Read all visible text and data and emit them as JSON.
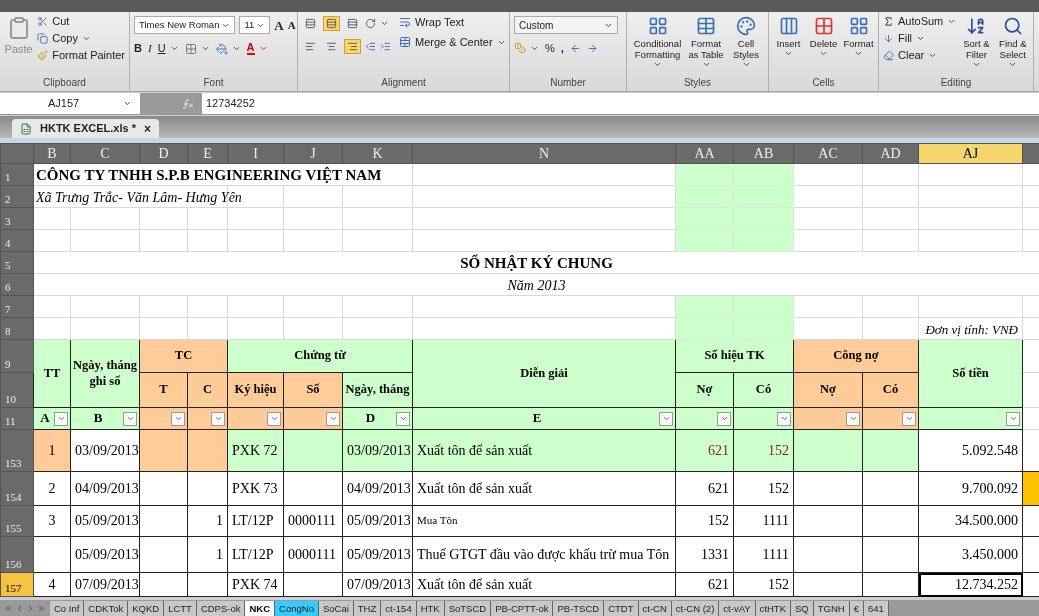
{
  "ribbon": {
    "clipboard": {
      "label": "Clipboard",
      "paste": "Paste",
      "cut": "Cut",
      "copy": "Copy",
      "format_painter": "Format Painter"
    },
    "font": {
      "label": "Font",
      "font_name": "Times New Roman",
      "font_size": "11",
      "grow": "A",
      "shrink": "A",
      "bold": "B",
      "italic": "I",
      "underline": "U",
      "font_color": "A"
    },
    "alignment": {
      "label": "Alignment",
      "vertical": [
        {
          "selected": false
        },
        {
          "selected": true
        },
        {
          "selected": false
        }
      ],
      "horizontal": [
        {
          "selected": false
        },
        {
          "selected": false
        },
        {
          "selected": true
        }
      ],
      "wrap_text": "Wrap Text",
      "merge_center": "Merge & Center"
    },
    "number": {
      "label": "Number",
      "format": "Custom",
      "percent": "%",
      "comma": ","
    },
    "styles": {
      "label": "Styles",
      "buttons": [
        "Conditional Formatting",
        "Format as Table",
        "Cell Styles"
      ]
    },
    "cells": {
      "label": "Cells",
      "buttons": [
        "Insert",
        "Delete",
        "Format"
      ]
    },
    "editing": {
      "label": "Editing",
      "autosum": "AutoSum",
      "fill": "Fill",
      "clear": "Clear",
      "buttons": [
        "Sort & Filter",
        "Find & Select"
      ]
    }
  },
  "formula_bar": {
    "name_box": "AJ157",
    "formula": "12734252"
  },
  "document_tab": {
    "title": "HKTK EXCEL.xls *",
    "close": "×"
  },
  "columns": [
    {
      "label": "B",
      "selected": false
    },
    {
      "label": "C",
      "selected": false
    },
    {
      "label": "D",
      "selected": false
    },
    {
      "label": "E",
      "selected": false
    },
    {
      "label": "I",
      "selected": false
    },
    {
      "label": "J",
      "selected": false
    },
    {
      "label": "K",
      "selected": false
    },
    {
      "label": "N",
      "selected": false
    },
    {
      "label": "AA",
      "selected": false
    },
    {
      "label": "AB",
      "selected": false
    },
    {
      "label": "AC",
      "selected": false
    },
    {
      "label": "AD",
      "selected": false
    },
    {
      "label": "AJ",
      "selected": true
    }
  ],
  "sheet_heading": {
    "company": "CÔNG TY TNHH S.P.B ENGINEERING VIỆT NAM",
    "address": "Xã Trưng Trắc- Văn Lâm- Hưng Yên",
    "title": "SỔ NHẬT KÝ CHUNG",
    "year": "Năm 2013",
    "unit": "Đơn vị tính: VNĐ"
  },
  "heading_rows": [
    "1",
    "2",
    "3",
    "4",
    "5",
    "6",
    "7",
    "8"
  ],
  "header_rows": [
    "9",
    "10",
    "11"
  ],
  "header_top": [
    {
      "text": "TT",
      "color": "#ccffcc"
    },
    {
      "text": "Ngày, tháng ghi sổ",
      "color": "#ccffcc"
    },
    {
      "text": "TC",
      "color": "#ffcc99"
    },
    {
      "text": "Chứng từ",
      "color": "#ccffcc"
    },
    {
      "text": "Diễn giải",
      "color": "#ccffcc"
    },
    {
      "text": "Số hiệu TK",
      "color": "#ccffcc"
    },
    {
      "text": "Công nợ",
      "color": "#ffcc99"
    },
    {
      "text": "Số tiền",
      "color": "#ccffcc"
    }
  ],
  "header_sub": [
    {
      "text": "T",
      "color": "#ffcc99"
    },
    {
      "text": "C",
      "color": "#ffcc99"
    },
    {
      "text": "Ký hiệu",
      "color": "#ffcc99"
    },
    {
      "text": "Số",
      "color": "#ffcc99"
    },
    {
      "text": "Ngày, tháng",
      "color": "#ccffcc"
    },
    {
      "text": "Nợ",
      "color": "#ccffcc"
    },
    {
      "text": "Có",
      "color": "#ccffcc"
    },
    {
      "text": "Nợ",
      "color": "#ffcc99"
    },
    {
      "text": "Có",
      "color": "#ffcc99"
    }
  ],
  "filter_row": [
    {
      "text": "A",
      "color": "#ccffcc"
    },
    {
      "text": "B",
      "color": "#ccffcc"
    },
    {
      "color": "#ffcc99"
    },
    {
      "color": "#ffcc99"
    },
    {
      "color": "#ffcc99"
    },
    {
      "color": "#ffcc99"
    },
    {
      "text": "D",
      "color": "#ccffcc"
    },
    {
      "text": "E",
      "color": "#ccffcc"
    },
    {
      "color": "#ccffcc"
    },
    {
      "color": "#ccffcc"
    },
    {
      "color": "#ffcc99"
    },
    {
      "color": "#ffcc99"
    },
    {
      "color": "#ccffcc"
    }
  ],
  "rows": [
    {
      "number": "153",
      "selected": false,
      "cells": [
        {
          "text": "1",
          "color": "#ffcc99"
        },
        "03/09/2013",
        {
          "color": "#ffcc99"
        },
        {
          "color": "#ffcc99"
        },
        {
          "text": "PXK 72",
          "color": "#ccffcc"
        },
        {
          "color": "#ccffcc"
        },
        {
          "text": "03/09/2013",
          "color": "#ccffcc"
        },
        {
          "text": "Xuất tôn để sản xuất",
          "color": "#ccffcc"
        },
        {
          "text": "621",
          "color": "#ccffcc",
          "flagged": true
        },
        {
          "text": "152",
          "color": "#ccffcc",
          "flagged": true
        },
        {
          "color": "#ccffcc"
        },
        {
          "color": "#ccffcc"
        },
        "5.092.548",
        null
      ]
    },
    {
      "number": "154",
      "selected": false,
      "cells": [
        "2",
        "04/09/2013",
        null,
        null,
        "PXK 73",
        null,
        "04/09/2013",
        "Xuất tôn để sản xuất",
        "621",
        "152",
        null,
        null,
        "9.700.092",
        {
          "color": "#ffc000"
        }
      ]
    },
    {
      "number": "155",
      "selected": false,
      "cells": [
        "3",
        "05/09/2013",
        null,
        "1",
        "LT/12P",
        "0000111",
        "05/09/2013",
        {
          "text": "Mua Tôn",
          "small": true
        },
        "152",
        "1111",
        null,
        null,
        "34.500.000",
        null
      ]
    },
    {
      "number": "156",
      "selected": false,
      "cells": [
        null,
        "05/09/2013",
        null,
        "1",
        "LT/12P",
        "0000111",
        "05/09/2013",
        "Thuế GTGT đầu vào được khấu trừ mua Tôn",
        "1331",
        "1111",
        null,
        null,
        "3.450.000",
        null
      ]
    },
    {
      "number": "157",
      "selected": true,
      "cells": [
        "4",
        "07/09/2013",
        null,
        null,
        "PXK 74",
        null,
        "07/09/2013",
        "Xuất tôn để sản xuất",
        "621",
        "152",
        null,
        null,
        "12.734.252",
        null
      ]
    }
  ],
  "sheet_tabs": [
    {
      "label": "Co Inf",
      "selected": false
    },
    {
      "label": "CDKTok",
      "selected": false
    },
    {
      "label": "KQKD",
      "selected": false
    },
    {
      "label": "LCTT",
      "selected": false
    },
    {
      "label": "CDPS-ok",
      "selected": false
    },
    {
      "label": "NKC",
      "selected": true
    },
    {
      "label": "CongNo",
      "selected": false,
      "color": "#33ccff"
    },
    {
      "label": "SoCai",
      "selected": false
    },
    {
      "label": "THZ",
      "selected": false
    },
    {
      "label": "ct-154",
      "selected": false
    },
    {
      "label": "HTK",
      "selected": false
    },
    {
      "label": "SoTSCD",
      "selected": false
    },
    {
      "label": "PB-CPTT-ok",
      "selected": false
    },
    {
      "label": "PB-TSCD",
      "selected": false
    },
    {
      "label": "CTDT",
      "selected": false
    },
    {
      "label": "ct-CN",
      "selected": false
    },
    {
      "label": "ct-CN (2)",
      "selected": false
    },
    {
      "label": "ct-vAY",
      "selected": false
    },
    {
      "label": "ctHTK",
      "selected": false
    },
    {
      "label": "SQ",
      "selected": false
    },
    {
      "label": "TGNH",
      "selected": false
    },
    {
      "label": "€",
      "selected": false
    },
    {
      "label": "641",
      "selected": false
    }
  ]
}
